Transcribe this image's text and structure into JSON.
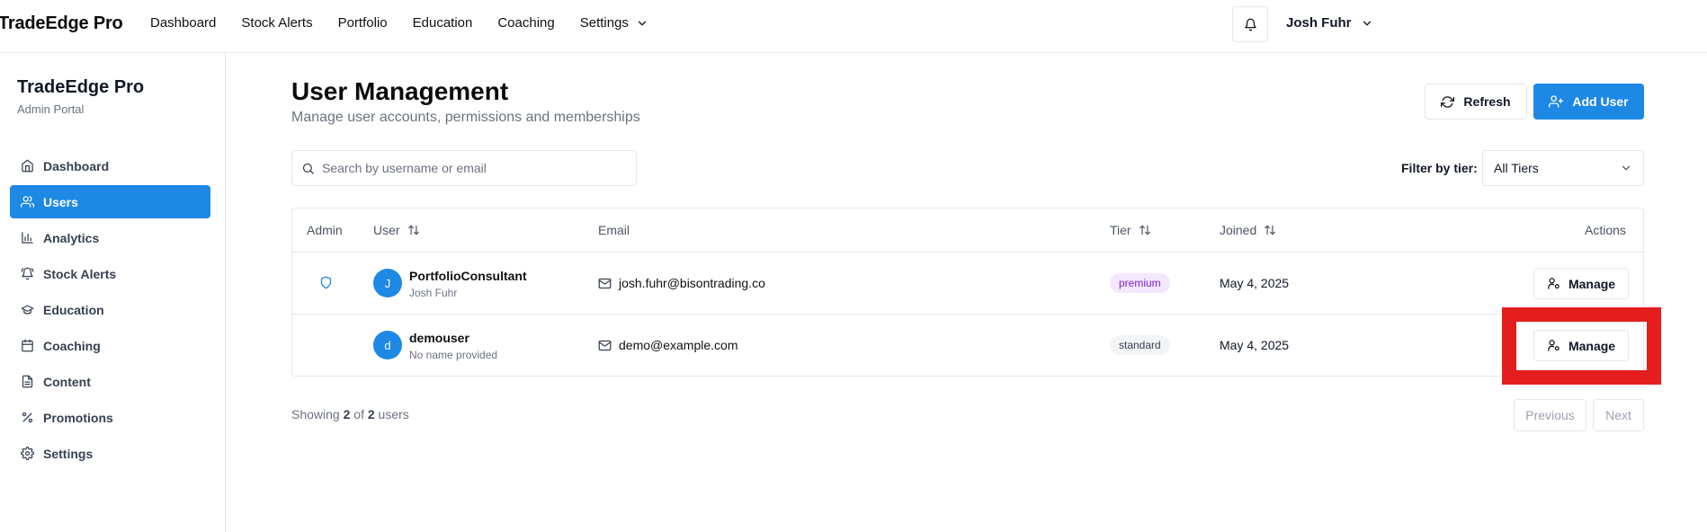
{
  "app": {
    "name": "TradeEdge Pro"
  },
  "topnav": {
    "items": [
      "Dashboard",
      "Stock Alerts",
      "Portfolio",
      "Education",
      "Coaching",
      "Settings"
    ],
    "user_name": "Josh Fuhr"
  },
  "sidebar": {
    "brand": "TradeEdge Pro",
    "subtitle": "Admin Portal",
    "items": [
      {
        "label": "Dashboard",
        "icon": "home-icon"
      },
      {
        "label": "Users",
        "icon": "users-icon",
        "active": true
      },
      {
        "label": "Analytics",
        "icon": "bar-chart-icon"
      },
      {
        "label": "Stock Alerts",
        "icon": "bell-icon"
      },
      {
        "label": "Education",
        "icon": "graduation-cap-icon"
      },
      {
        "label": "Coaching",
        "icon": "calendar-icon"
      },
      {
        "label": "Content",
        "icon": "file-icon"
      },
      {
        "label": "Promotions",
        "icon": "percent-icon"
      },
      {
        "label": "Settings",
        "icon": "gear-icon"
      }
    ]
  },
  "main": {
    "title": "User Management",
    "subtitle": "Manage user accounts, permissions and memberships",
    "refresh_label": "Refresh",
    "add_user_label": "Add User",
    "search_placeholder": "Search by username or email",
    "filter_label": "Filter by tier:",
    "filter_value": "All Tiers"
  },
  "table": {
    "columns": {
      "admin": "Admin",
      "user": "User",
      "email": "Email",
      "tier": "Tier",
      "joined": "Joined",
      "actions": "Actions"
    },
    "rows": [
      {
        "is_admin": true,
        "initial": "J",
        "username": "PortfolioConsultant",
        "name": "Josh Fuhr",
        "email": "josh.fuhr@bisontrading.co",
        "tier": "premium",
        "joined": "May 4, 2025",
        "action": "Manage"
      },
      {
        "is_admin": false,
        "initial": "d",
        "username": "demouser",
        "name": "No name provided",
        "email": "demo@example.com",
        "tier": "standard",
        "joined": "May 4, 2025",
        "action": "Manage"
      }
    ]
  },
  "pagination": {
    "showing_prefix": "Showing",
    "showing_count": "2",
    "showing_of": "of",
    "showing_total": "2",
    "showing_suffix": "users",
    "previous_label": "Previous",
    "next_label": "Next"
  },
  "colors": {
    "primary": "#1e88e5",
    "highlight": "#e41e1e",
    "premium_bg": "#f3e8ff",
    "premium_text": "#7e22ce"
  }
}
